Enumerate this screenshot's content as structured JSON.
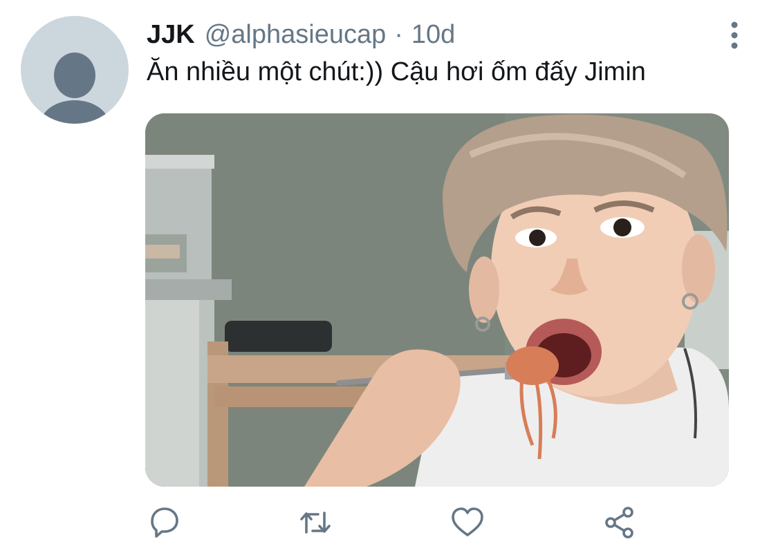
{
  "tweet": {
    "author": {
      "display_name": "JJK",
      "handle": "@alphasieucap",
      "avatar_icon": "default-profile-icon"
    },
    "separator": "·",
    "timestamp": "10d",
    "text": "Ăn nhiều một chút:)) Cậu hơi ốm đấy Jimin",
    "media": {
      "type": "photo",
      "icon": "photo-person-eating-noodles"
    },
    "actions": [
      {
        "name": "reply",
        "icon": "reply-icon"
      },
      {
        "name": "retweet",
        "icon": "retweet-icon"
      },
      {
        "name": "like",
        "icon": "heart-icon"
      },
      {
        "name": "share",
        "icon": "share-icon"
      }
    ],
    "more_icon": "more-vertical-icon"
  },
  "colors": {
    "text_primary": "#14171a",
    "text_secondary": "#657786",
    "avatar_bg": "#ccd6dd",
    "avatar_figure": "#657786"
  }
}
